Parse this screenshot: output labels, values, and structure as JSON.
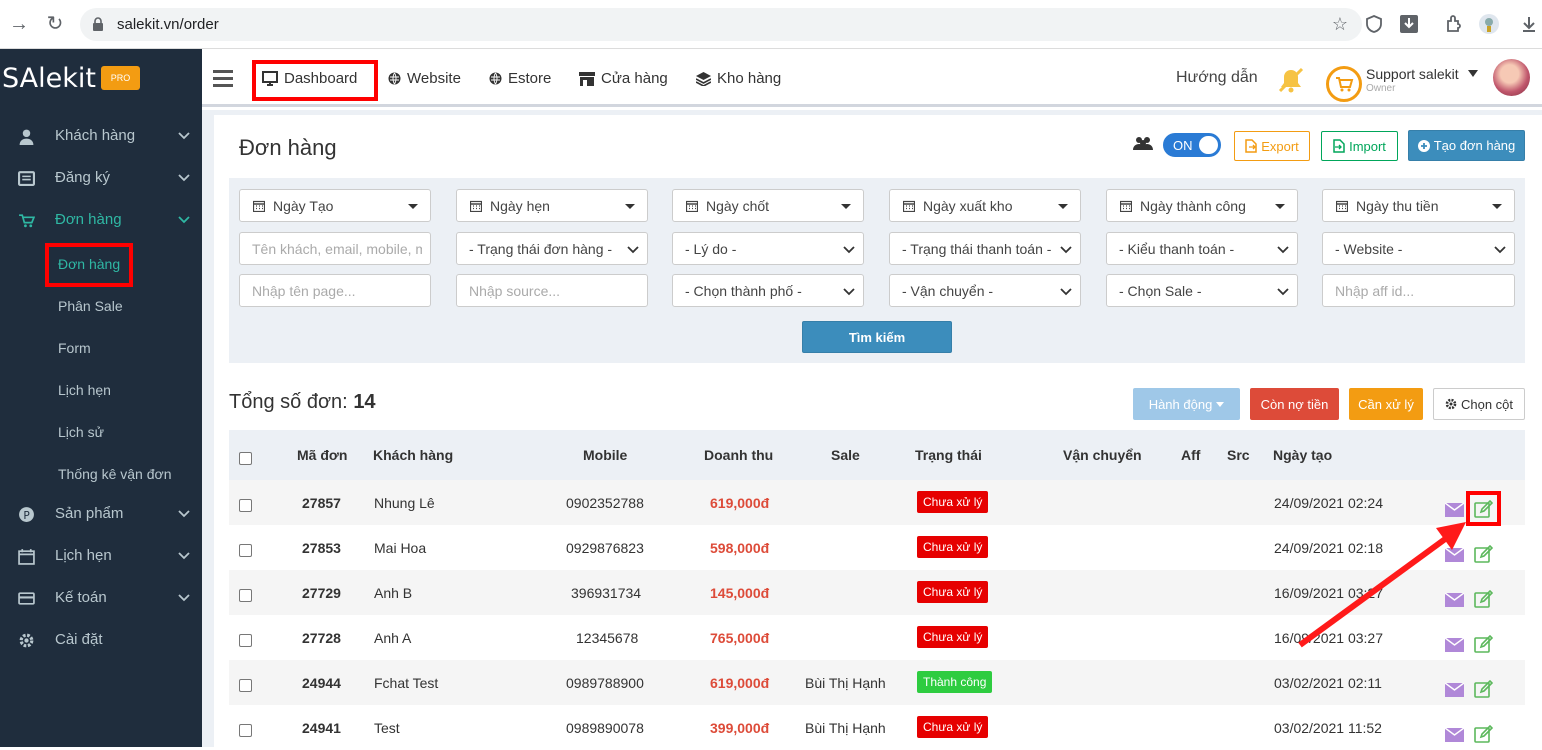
{
  "browser": {
    "url": "salekit.vn/order"
  },
  "sidebar": {
    "brand": "SAlekit",
    "badge": "PRO",
    "items": [
      {
        "label": "Khách hàng",
        "icon": "user-icon"
      },
      {
        "label": "Đăng ký",
        "icon": "list-icon"
      },
      {
        "label": "Đơn hàng",
        "icon": "cart-icon"
      },
      {
        "label": "Sản phẩm",
        "icon": "product-icon"
      },
      {
        "label": "Lịch hẹn",
        "icon": "calendar-icon"
      },
      {
        "label": "Kế toán",
        "icon": "credit-card-icon"
      },
      {
        "label": "Cài đặt",
        "icon": "gear-icon"
      }
    ],
    "subitems": [
      "Đơn hàng",
      "Phân Sale",
      "Form",
      "Lịch hẹn",
      "Lịch sử",
      "Thống kê vận đơn"
    ]
  },
  "topnav": {
    "items": [
      "Dashboard",
      "Website",
      "Estore",
      "Cửa hàng",
      "Kho hàng"
    ],
    "guide": "Hướng dẫn",
    "user_name": "Support salekit",
    "user_role": "Owner"
  },
  "page": {
    "title": "Đơn hàng",
    "toggle": "ON",
    "export": "Export",
    "import": "Import",
    "create": "Tạo đơn hàng"
  },
  "filters": {
    "dates": [
      "Ngày Tạo",
      "Ngày hẹn",
      "Ngày chốt",
      "Ngày xuất kho",
      "Ngày thành công",
      "Ngày thu tiền"
    ],
    "customer_placeholder": "Tên khách, email, mobile, m",
    "selects1": [
      "- Trạng thái đơn hàng -",
      "- Lý do -",
      "- Trạng thái thanh toán -",
      "- Kiểu thanh toán -",
      "- Website -"
    ],
    "page_placeholder": "Nhập tên page...",
    "source_placeholder": "Nhập source...",
    "selects2": [
      "- Chọn thành phố -",
      "- Vận chuyển -",
      "- Chọn Sale -"
    ],
    "aff_placeholder": "Nhập aff id...",
    "search": "Tìm kiếm"
  },
  "summary": {
    "total_label": "Tổng số đơn:",
    "total_value": "14",
    "action": "Hành động",
    "debt": "Còn nợ tiền",
    "handle": "Cần xử lý",
    "columns": "Chọn cột"
  },
  "table": {
    "headers": [
      "Mã đơn",
      "Khách hàng",
      "Mobile",
      "Doanh thu",
      "Sale",
      "Trạng thái",
      "Vận chuyển",
      "Aff",
      "Src",
      "Ngày tạo"
    ],
    "rows": [
      {
        "code": "27857",
        "customer": "Nhung Lê",
        "mobile": "0902352788",
        "revenue": "619,000đ",
        "sale": "",
        "status": "Chưa xử lý",
        "date": "24/09/2021 02:24"
      },
      {
        "code": "27853",
        "customer": "Mai Hoa",
        "mobile": "0929876823",
        "revenue": "598,000đ",
        "sale": "",
        "status": "Chưa xử lý",
        "date": "24/09/2021 02:18"
      },
      {
        "code": "27729",
        "customer": "Anh B",
        "mobile": "396931734",
        "revenue": "145,000đ",
        "sale": "",
        "status": "Chưa xử lý",
        "date": "16/09/2021 03:27"
      },
      {
        "code": "27728",
        "customer": "Anh A",
        "mobile": "12345678",
        "revenue": "765,000đ",
        "sale": "",
        "status": "Chưa xử lý",
        "date": "16/09/2021 03:27"
      },
      {
        "code": "24944",
        "customer": "Fchat Test",
        "mobile": "0989788900",
        "revenue": "619,000đ",
        "sale": "Bùi Thị Hạnh",
        "status": "Thành công",
        "date": "03/02/2021 02:11"
      },
      {
        "code": "24941",
        "customer": "Test",
        "mobile": "0989890078",
        "revenue": "399,000đ",
        "sale": "Bùi Thị Hạnh",
        "status": "Chưa xử lý",
        "date": "03/02/2021 11:52"
      }
    ]
  },
  "colors": {
    "sidebar": "#1f2d3d",
    "accent": "#2fb8a4",
    "primary": "#3c8dbc",
    "danger": "#dd4b39",
    "warning": "#f39c12",
    "success": "#00a65a",
    "highlight": "#ff0000"
  }
}
